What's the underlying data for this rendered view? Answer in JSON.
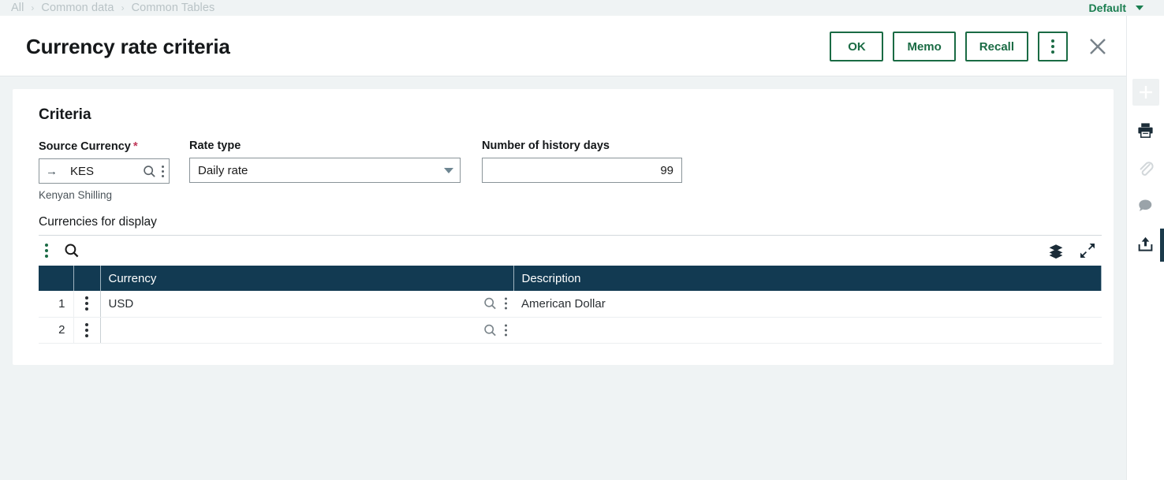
{
  "breadcrumb": {
    "items": [
      "All",
      "Common data",
      "Common Tables"
    ],
    "separator": "›"
  },
  "workspace": {
    "label": "Default",
    "caret_icon": "chevron-down-icon"
  },
  "header": {
    "title": "Currency rate criteria",
    "actions": {
      "ok_label": "OK",
      "memo_label": "Memo",
      "recall_label": "Recall",
      "overflow_icon": "vertical-dots-icon",
      "close_icon": "close-icon"
    }
  },
  "criteria": {
    "section_title": "Criteria",
    "source_currency": {
      "label": "Source Currency",
      "required_marker": "*",
      "prefix_icon": "arrow-right-icon",
      "value": "KES",
      "lookup_icon": "search-icon",
      "menu_icon": "vertical-dots-icon",
      "helper_text": "Kenyan Shilling"
    },
    "rate_type": {
      "label": "Rate type",
      "value": "Daily rate",
      "caret_icon": "chevron-down-icon",
      "options": [
        "Daily rate"
      ]
    },
    "history_days": {
      "label": "Number of history days",
      "value": "99"
    }
  },
  "grid": {
    "caption": "Currencies for display",
    "toolbar": {
      "menu_icon": "vertical-dots-icon",
      "search_icon": "search-icon",
      "layers_icon": "layers-icon",
      "expand_icon": "expand-icon"
    },
    "columns": [
      "Currency",
      "Description"
    ],
    "rows": [
      {
        "num": "1",
        "currency": "USD",
        "description": "American Dollar"
      },
      {
        "num": "2",
        "currency": "",
        "description": ""
      }
    ],
    "row_menu_icon": "vertical-dots-icon",
    "cell_lookup_icon": "search-icon",
    "cell_menu_icon": "vertical-dots-icon"
  },
  "right_rail": {
    "items": [
      {
        "name": "add-icon",
        "title": "Add"
      },
      {
        "name": "print-icon",
        "title": "Print"
      },
      {
        "name": "attach-icon",
        "title": "Attachments"
      },
      {
        "name": "comment-icon",
        "title": "Comments"
      },
      {
        "name": "share-icon",
        "title": "Share"
      }
    ]
  },
  "colors": {
    "accent_green": "#1a6b44",
    "header_navy": "#123a52",
    "header_navy_light": "#2e5468",
    "page_background": "#eff3f4",
    "required_star": "#c0395a"
  }
}
